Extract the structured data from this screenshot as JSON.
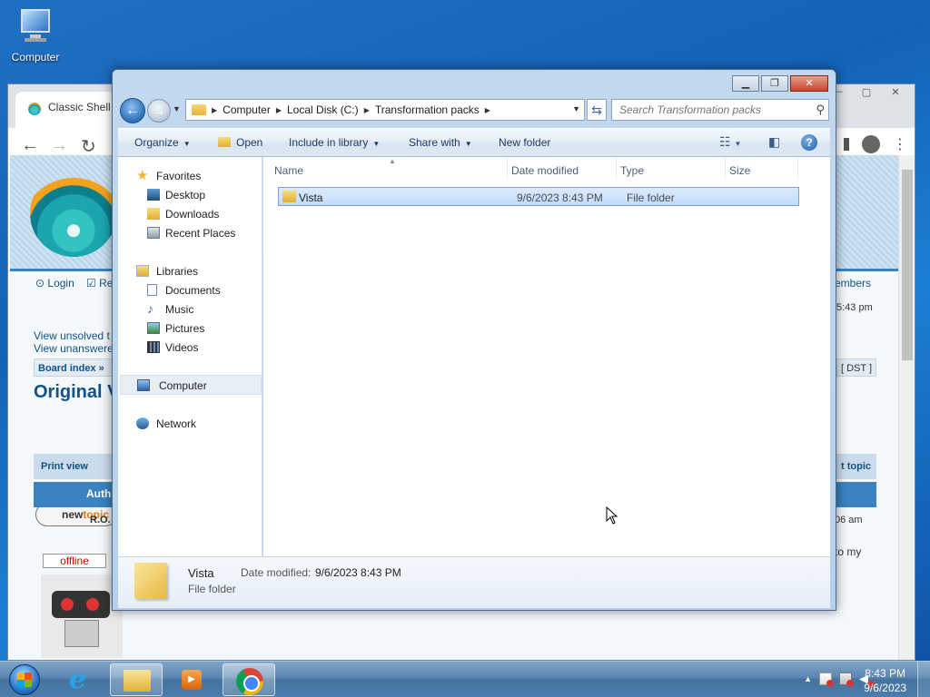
{
  "desktop": {
    "computer_label": "Computer"
  },
  "browser": {
    "tab_title": "Classic Shell",
    "links": {
      "login": "Login",
      "register_partial": "Re",
      "members_partial": "embers",
      "time_partial": "5:43 pm",
      "view_unsolved": "View unsolved t",
      "view_unanswered": "View unanswere",
      "board_index": "Board index »",
      "dst": "[ DST ]",
      "page_title_partial": "Original V",
      "new_topic_new": "new",
      "new_topic_topic": "topic",
      "print_view": "Print view",
      "post_topic_partial": "t topic",
      "author_partial": "Auth",
      "author_name_partial": "R.O.",
      "post_time_partial": "06 am",
      "post_text_partial": "to my",
      "offline": "offline"
    }
  },
  "explorer": {
    "address": {
      "crumbs": [
        "Computer",
        "Local Disk (C:)",
        "Transformation packs"
      ]
    },
    "search_placeholder": "Search Transformation packs",
    "commands": {
      "organize": "Organize",
      "open": "Open",
      "include_in_library": "Include in library",
      "share_with": "Share with",
      "new_folder": "New folder"
    },
    "nav": {
      "favorites": "Favorites",
      "desktop": "Desktop",
      "downloads": "Downloads",
      "recent_places": "Recent Places",
      "libraries": "Libraries",
      "documents": "Documents",
      "music": "Music",
      "pictures": "Pictures",
      "videos": "Videos",
      "computer": "Computer",
      "network": "Network"
    },
    "columns": {
      "name": "Name",
      "date_modified": "Date modified",
      "type": "Type",
      "size": "Size"
    },
    "files": [
      {
        "name": "Vista",
        "date_modified": "9/6/2023 8:43 PM",
        "type": "File folder",
        "size": ""
      }
    ],
    "details": {
      "name": "Vista",
      "type": "File folder",
      "date_label": "Date modified:",
      "date_value": "9/6/2023 8:43 PM"
    }
  },
  "taskbar": {
    "time": "8:43 PM",
    "date": "9/6/2023"
  }
}
